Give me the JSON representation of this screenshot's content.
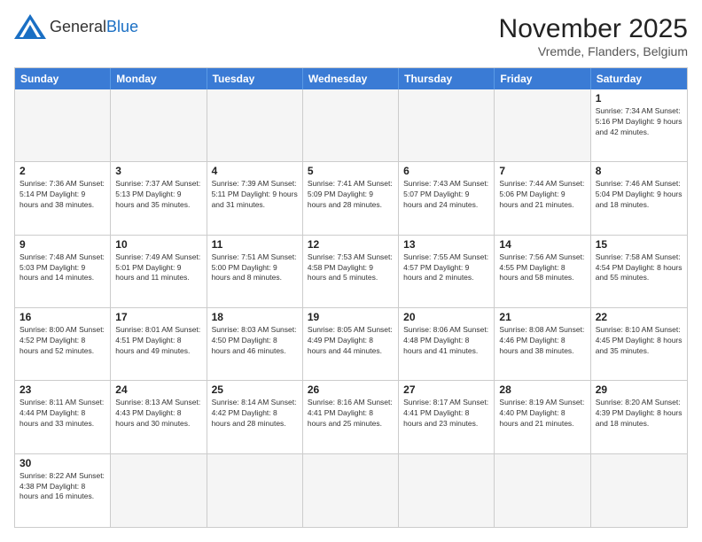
{
  "header": {
    "logo_general": "General",
    "logo_blue": "Blue",
    "month_year": "November 2025",
    "location": "Vremde, Flanders, Belgium"
  },
  "days_of_week": [
    "Sunday",
    "Monday",
    "Tuesday",
    "Wednesday",
    "Thursday",
    "Friday",
    "Saturday"
  ],
  "weeks": [
    [
      {
        "day": "",
        "info": ""
      },
      {
        "day": "",
        "info": ""
      },
      {
        "day": "",
        "info": ""
      },
      {
        "day": "",
        "info": ""
      },
      {
        "day": "",
        "info": ""
      },
      {
        "day": "",
        "info": ""
      },
      {
        "day": "1",
        "info": "Sunrise: 7:34 AM\nSunset: 5:16 PM\nDaylight: 9 hours\nand 42 minutes."
      }
    ],
    [
      {
        "day": "2",
        "info": "Sunrise: 7:36 AM\nSunset: 5:14 PM\nDaylight: 9 hours\nand 38 minutes."
      },
      {
        "day": "3",
        "info": "Sunrise: 7:37 AM\nSunset: 5:13 PM\nDaylight: 9 hours\nand 35 minutes."
      },
      {
        "day": "4",
        "info": "Sunrise: 7:39 AM\nSunset: 5:11 PM\nDaylight: 9 hours\nand 31 minutes."
      },
      {
        "day": "5",
        "info": "Sunrise: 7:41 AM\nSunset: 5:09 PM\nDaylight: 9 hours\nand 28 minutes."
      },
      {
        "day": "6",
        "info": "Sunrise: 7:43 AM\nSunset: 5:07 PM\nDaylight: 9 hours\nand 24 minutes."
      },
      {
        "day": "7",
        "info": "Sunrise: 7:44 AM\nSunset: 5:06 PM\nDaylight: 9 hours\nand 21 minutes."
      },
      {
        "day": "8",
        "info": "Sunrise: 7:46 AM\nSunset: 5:04 PM\nDaylight: 9 hours\nand 18 minutes."
      }
    ],
    [
      {
        "day": "9",
        "info": "Sunrise: 7:48 AM\nSunset: 5:03 PM\nDaylight: 9 hours\nand 14 minutes."
      },
      {
        "day": "10",
        "info": "Sunrise: 7:49 AM\nSunset: 5:01 PM\nDaylight: 9 hours\nand 11 minutes."
      },
      {
        "day": "11",
        "info": "Sunrise: 7:51 AM\nSunset: 5:00 PM\nDaylight: 9 hours\nand 8 minutes."
      },
      {
        "day": "12",
        "info": "Sunrise: 7:53 AM\nSunset: 4:58 PM\nDaylight: 9 hours\nand 5 minutes."
      },
      {
        "day": "13",
        "info": "Sunrise: 7:55 AM\nSunset: 4:57 PM\nDaylight: 9 hours\nand 2 minutes."
      },
      {
        "day": "14",
        "info": "Sunrise: 7:56 AM\nSunset: 4:55 PM\nDaylight: 8 hours\nand 58 minutes."
      },
      {
        "day": "15",
        "info": "Sunrise: 7:58 AM\nSunset: 4:54 PM\nDaylight: 8 hours\nand 55 minutes."
      }
    ],
    [
      {
        "day": "16",
        "info": "Sunrise: 8:00 AM\nSunset: 4:52 PM\nDaylight: 8 hours\nand 52 minutes."
      },
      {
        "day": "17",
        "info": "Sunrise: 8:01 AM\nSunset: 4:51 PM\nDaylight: 8 hours\nand 49 minutes."
      },
      {
        "day": "18",
        "info": "Sunrise: 8:03 AM\nSunset: 4:50 PM\nDaylight: 8 hours\nand 46 minutes."
      },
      {
        "day": "19",
        "info": "Sunrise: 8:05 AM\nSunset: 4:49 PM\nDaylight: 8 hours\nand 44 minutes."
      },
      {
        "day": "20",
        "info": "Sunrise: 8:06 AM\nSunset: 4:48 PM\nDaylight: 8 hours\nand 41 minutes."
      },
      {
        "day": "21",
        "info": "Sunrise: 8:08 AM\nSunset: 4:46 PM\nDaylight: 8 hours\nand 38 minutes."
      },
      {
        "day": "22",
        "info": "Sunrise: 8:10 AM\nSunset: 4:45 PM\nDaylight: 8 hours\nand 35 minutes."
      }
    ],
    [
      {
        "day": "23",
        "info": "Sunrise: 8:11 AM\nSunset: 4:44 PM\nDaylight: 8 hours\nand 33 minutes."
      },
      {
        "day": "24",
        "info": "Sunrise: 8:13 AM\nSunset: 4:43 PM\nDaylight: 8 hours\nand 30 minutes."
      },
      {
        "day": "25",
        "info": "Sunrise: 8:14 AM\nSunset: 4:42 PM\nDaylight: 8 hours\nand 28 minutes."
      },
      {
        "day": "26",
        "info": "Sunrise: 8:16 AM\nSunset: 4:41 PM\nDaylight: 8 hours\nand 25 minutes."
      },
      {
        "day": "27",
        "info": "Sunrise: 8:17 AM\nSunset: 4:41 PM\nDaylight: 8 hours\nand 23 minutes."
      },
      {
        "day": "28",
        "info": "Sunrise: 8:19 AM\nSunset: 4:40 PM\nDaylight: 8 hours\nand 21 minutes."
      },
      {
        "day": "29",
        "info": "Sunrise: 8:20 AM\nSunset: 4:39 PM\nDaylight: 8 hours\nand 18 minutes."
      }
    ],
    [
      {
        "day": "30",
        "info": "Sunrise: 8:22 AM\nSunset: 4:38 PM\nDaylight: 8 hours\nand 16 minutes."
      },
      {
        "day": "",
        "info": ""
      },
      {
        "day": "",
        "info": ""
      },
      {
        "day": "",
        "info": ""
      },
      {
        "day": "",
        "info": ""
      },
      {
        "day": "",
        "info": ""
      },
      {
        "day": "",
        "info": ""
      }
    ]
  ]
}
